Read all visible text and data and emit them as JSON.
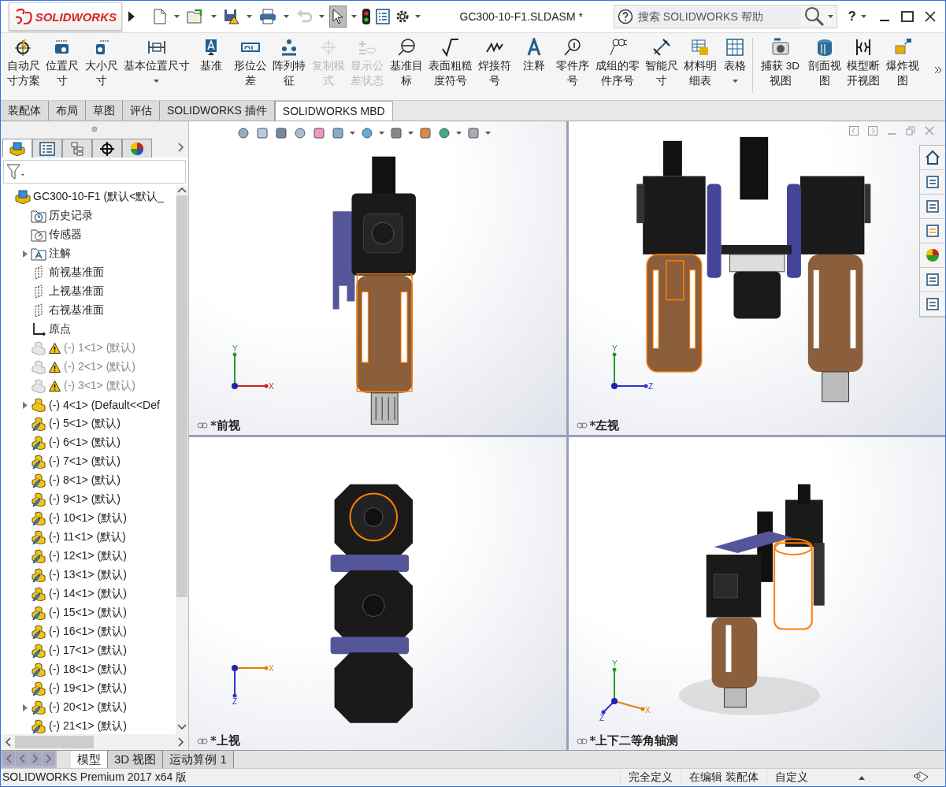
{
  "title_bar": {
    "logo": "SOLIDWORKS",
    "document_title": "GC300-10-F1.SLDASM *",
    "search": {
      "placeholder": "搜索 SOLIDWORKS 帮助"
    },
    "help": "?"
  },
  "ribbon": [
    {
      "label": "自动尺寸方案",
      "disabled": false,
      "dropdown": false,
      "separator_before": false
    },
    {
      "label": "位置尺寸",
      "disabled": false,
      "dropdown": false,
      "separator_before": false
    },
    {
      "label": "大小尺寸",
      "disabled": false,
      "dropdown": false,
      "separator_before": false
    },
    {
      "label": "基本位置尺寸",
      "disabled": false,
      "dropdown": true,
      "separator_before": false
    },
    {
      "label": "基准",
      "disabled": false,
      "dropdown": false,
      "separator_before": false
    },
    {
      "label": "形位公差",
      "disabled": false,
      "dropdown": false,
      "separator_before": false
    },
    {
      "label": "阵列特征",
      "disabled": false,
      "dropdown": false,
      "separator_before": false
    },
    {
      "label": "复制模式",
      "disabled": true,
      "dropdown": false,
      "separator_before": false
    },
    {
      "label": "显示公差状态",
      "disabled": true,
      "dropdown": false,
      "separator_before": false
    },
    {
      "label": "基准目标",
      "disabled": false,
      "dropdown": false,
      "separator_before": false
    },
    {
      "label": "表面粗糙度符号",
      "disabled": false,
      "dropdown": false,
      "separator_before": false
    },
    {
      "label": "焊接符号",
      "disabled": false,
      "dropdown": false,
      "separator_before": false
    },
    {
      "label": "注释",
      "disabled": false,
      "dropdown": false,
      "separator_before": false
    },
    {
      "label": "零件序号",
      "disabled": false,
      "dropdown": false,
      "separator_before": false
    },
    {
      "label": "成组的零件序号",
      "disabled": false,
      "dropdown": false,
      "separator_before": false
    },
    {
      "label": "智能尺寸",
      "disabled": false,
      "dropdown": false,
      "separator_before": false
    },
    {
      "label": "材料明细表",
      "disabled": false,
      "dropdown": false,
      "separator_before": false
    },
    {
      "label": "表格",
      "disabled": false,
      "dropdown": true,
      "separator_before": false
    },
    {
      "label": "捕获 3D 视图",
      "disabled": false,
      "dropdown": false,
      "separator_before": true
    },
    {
      "label": "剖面视图",
      "disabled": false,
      "dropdown": false,
      "separator_before": false
    },
    {
      "label": "模型断开视图",
      "disabled": false,
      "dropdown": false,
      "separator_before": false
    },
    {
      "label": "爆炸视图",
      "disabled": false,
      "dropdown": false,
      "separator_before": false
    }
  ],
  "command_tabs": [
    {
      "label": "装配体",
      "selected": false
    },
    {
      "label": "布局",
      "selected": false
    },
    {
      "label": "草图",
      "selected": false
    },
    {
      "label": "评估",
      "selected": false
    },
    {
      "label": "SOLIDWORKS 插件",
      "selected": false
    },
    {
      "label": "SOLIDWORKS MBD",
      "selected": true
    }
  ],
  "panel_tabs": [
    {
      "selected": true
    },
    {
      "selected": false
    },
    {
      "selected": false
    },
    {
      "selected": false
    },
    {
      "selected": false
    }
  ],
  "tree": [
    {
      "label": "GC300-10-F1  (默认<默认_",
      "kind": "assembly",
      "collapsed": false,
      "suppressed": false,
      "children": [
        {
          "label": "历史记录",
          "kind": "history",
          "collapsed": false,
          "suppressed": false
        },
        {
          "label": "传感器",
          "kind": "sensor",
          "collapsed": false,
          "suppressed": false
        },
        {
          "label": "注解",
          "kind": "annotations",
          "collapsed": true,
          "suppressed": false
        },
        {
          "label": "前视基准面",
          "kind": "plane",
          "collapsed": false,
          "suppressed": false
        },
        {
          "label": "上视基准面",
          "kind": "plane",
          "collapsed": false,
          "suppressed": false
        },
        {
          "label": "右视基准面",
          "kind": "plane",
          "collapsed": false,
          "suppressed": false
        },
        {
          "label": "原点",
          "kind": "origin",
          "collapsed": false,
          "suppressed": false
        },
        {
          "label": "(-) 1<1> (默认)",
          "kind": "component",
          "collapsed": false,
          "suppressed": true
        },
        {
          "label": "(-) 2<1> (默认)",
          "kind": "component",
          "collapsed": false,
          "suppressed": true
        },
        {
          "label": "(-) 3<1> (默认)",
          "kind": "component",
          "collapsed": false,
          "suppressed": true
        },
        {
          "label": "(-) 4<1> (Default<<Def",
          "kind": "component",
          "collapsed": true,
          "suppressed": false
        },
        {
          "label": "(-) 5<1> (默认)",
          "kind": "flexible-component",
          "collapsed": false,
          "suppressed": false
        },
        {
          "label": "(-) 6<1> (默认)",
          "kind": "flexible-component",
          "collapsed": false,
          "suppressed": false
        },
        {
          "label": "(-) 7<1> (默认)",
          "kind": "flexible-component",
          "collapsed": false,
          "suppressed": false
        },
        {
          "label": "(-) 8<1> (默认)",
          "kind": "flexible-component",
          "collapsed": false,
          "suppressed": false
        },
        {
          "label": "(-) 9<1> (默认)",
          "kind": "flexible-component",
          "collapsed": false,
          "suppressed": false
        },
        {
          "label": "(-) 10<1> (默认)",
          "kind": "flexible-component",
          "collapsed": false,
          "suppressed": false
        },
        {
          "label": "(-) 11<1> (默认)",
          "kind": "flexible-component",
          "collapsed": false,
          "suppressed": false
        },
        {
          "label": "(-) 12<1> (默认)",
          "kind": "flexible-component",
          "collapsed": false,
          "suppressed": false
        },
        {
          "label": "(-) 13<1> (默认)",
          "kind": "flexible-component",
          "collapsed": false,
          "suppressed": false
        },
        {
          "label": "(-) 14<1> (默认)",
          "kind": "flexible-component",
          "collapsed": false,
          "suppressed": false
        },
        {
          "label": "(-) 15<1> (默认)",
          "kind": "flexible-component",
          "collapsed": false,
          "suppressed": false
        },
        {
          "label": "(-) 16<1> (默认)",
          "kind": "flexible-component",
          "collapsed": false,
          "suppressed": false
        },
        {
          "label": "(-) 17<1> (默认)",
          "kind": "flexible-component",
          "collapsed": false,
          "suppressed": false
        },
        {
          "label": "(-) 18<1> (默认)",
          "kind": "flexible-component",
          "collapsed": false,
          "suppressed": false
        },
        {
          "label": "(-) 19<1> (默认)",
          "kind": "flexible-component",
          "collapsed": false,
          "suppressed": false
        },
        {
          "label": "(-) 20<1> (默认)",
          "kind": "flexible-component",
          "collapsed": true,
          "suppressed": false
        },
        {
          "label": "(-) 21<1> (默认)",
          "kind": "flexible-component",
          "collapsed": false,
          "suppressed": false
        }
      ]
    }
  ],
  "viewports": [
    {
      "kind": "front",
      "label": "*前视",
      "axes": [
        "Y",
        "X"
      ]
    },
    {
      "kind": "left",
      "label": "*左视",
      "axes": [
        "Y",
        "Z"
      ]
    },
    {
      "kind": "top",
      "label": "*上视",
      "axes": [
        "X",
        "Z"
      ]
    },
    {
      "kind": "isometric",
      "label": "*上下二等角轴测",
      "axes": [
        "Y",
        "X",
        "Z"
      ]
    }
  ],
  "bottom_tabs": [
    {
      "label": "模型",
      "selected": true
    },
    {
      "label": "3D 视图",
      "selected": false
    },
    {
      "label": "运动算例 1",
      "selected": false
    }
  ],
  "status_bar": {
    "product": "SOLIDWORKS Premium 2017 x64 版",
    "fields": [
      "完全定义",
      "在编辑 装配体",
      "自定义"
    ]
  }
}
